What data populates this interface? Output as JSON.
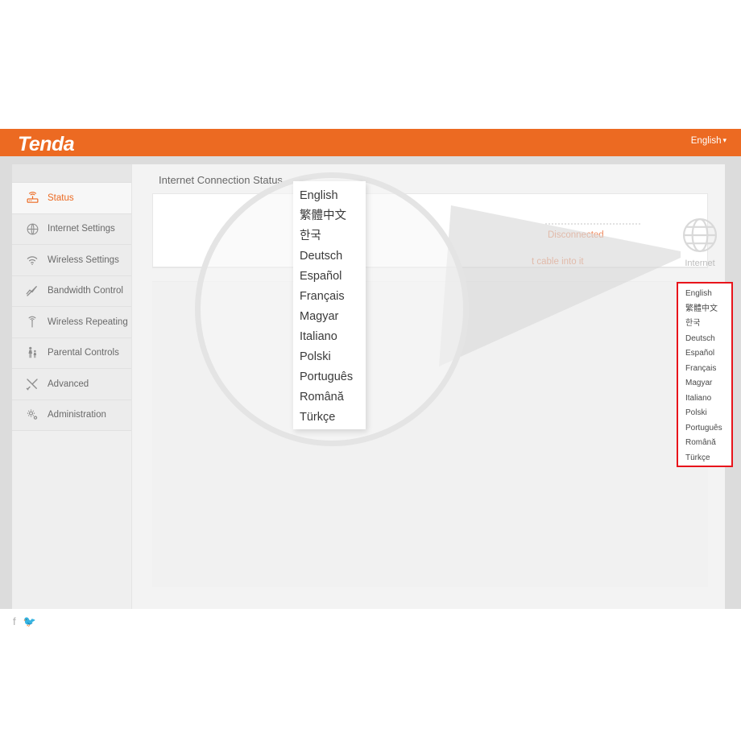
{
  "header": {
    "brand": "Tenda",
    "language_label": "English",
    "caret": "▾"
  },
  "sidebar": {
    "items": [
      {
        "label": "Status",
        "icon": "router-icon",
        "active": true
      },
      {
        "label": "Internet Settings",
        "icon": "globe-icon",
        "active": false
      },
      {
        "label": "Wireless Settings",
        "icon": "wifi-icon",
        "active": false
      },
      {
        "label": "Bandwidth Control",
        "icon": "trend-line-icon",
        "active": false
      },
      {
        "label": "Wireless Repeating",
        "icon": "antenna-icon",
        "active": false
      },
      {
        "label": "Parental Controls",
        "icon": "parent-child-icon",
        "active": false
      },
      {
        "label": "Advanced",
        "icon": "tools-icon",
        "active": false
      },
      {
        "label": "Administration",
        "icon": "gear-icon",
        "active": false
      }
    ],
    "social": [
      {
        "name": "facebook-icon",
        "glyph": "f"
      },
      {
        "name": "twitter-icon",
        "glyph": "🐦"
      }
    ]
  },
  "main": {
    "title": "Internet Connection Status",
    "status_text": "Disconnected",
    "hint_text": "t cable into it",
    "internet_label": "Internet"
  },
  "language_dropdown": {
    "options": [
      "English",
      "繁體中文",
      "한국",
      "Deutsch",
      "Español",
      "Français",
      "Magyar",
      "Italiano",
      "Polski",
      "Português",
      "Română",
      "Türkçe"
    ],
    "highlight_color": "#e8141b"
  },
  "magnifier": {
    "options": [
      "English",
      "繁體中文",
      "한국",
      "Deutsch",
      "Español",
      "Français",
      "Magyar",
      "Italiano",
      "Polski",
      "Português",
      "Română",
      "Türkçe"
    ]
  },
  "colors": {
    "brand_orange": "#ec6a22",
    "status_orange": "#ef8a5f",
    "highlight_red": "#e8141b"
  }
}
